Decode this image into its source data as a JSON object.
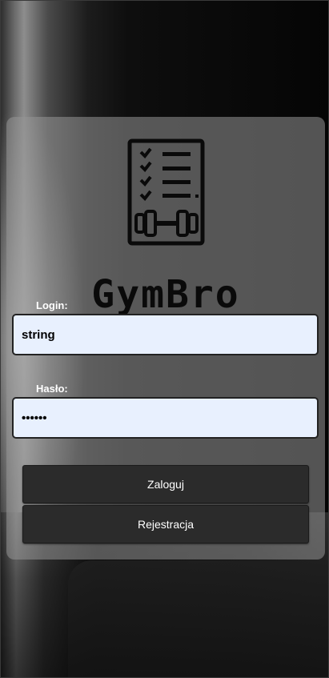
{
  "brand": {
    "name": "GymBro",
    "logo_icon": "checklist-dumbbell-icon"
  },
  "login_form": {
    "login_label": "Login:",
    "login_value": "string",
    "password_label": "Hasło:",
    "password_value": "string"
  },
  "actions": {
    "login_button": "Zaloguj",
    "register_button": "Rejestracja"
  }
}
